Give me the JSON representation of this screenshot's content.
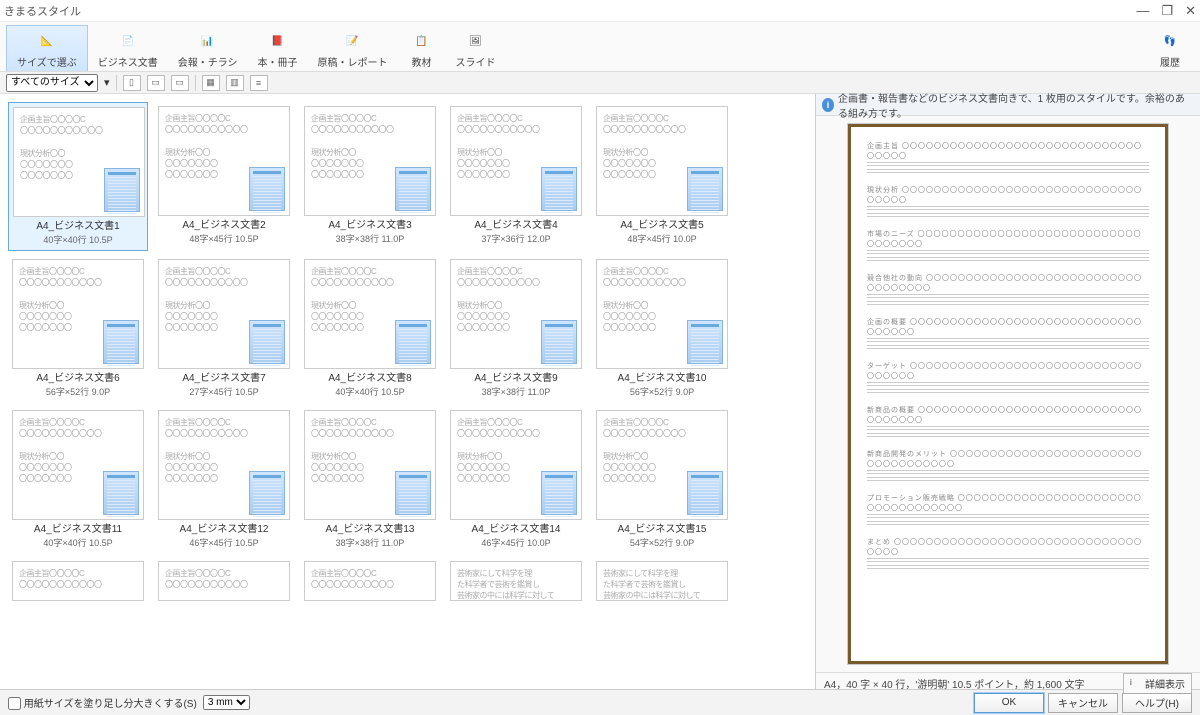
{
  "window": {
    "title": "きまるスタイル"
  },
  "win_ctrls": {
    "min": "—",
    "max": "❐",
    "close": "✕"
  },
  "ribbon": {
    "items": [
      {
        "label": "サイズで選ぶ",
        "active": true
      },
      {
        "label": "ビジネス文書"
      },
      {
        "label": "会報・チラシ"
      },
      {
        "label": "本・冊子"
      },
      {
        "label": "原稿・レポート"
      },
      {
        "label": "教材"
      },
      {
        "label": "スライド"
      }
    ],
    "right_label": "履歴"
  },
  "toolbar2": {
    "size_dropdown": "すべてのサイズ"
  },
  "placeholder": {
    "heading": "企画主旨〇〇〇〇C",
    "line": "〇〇〇〇〇〇〇〇〇〇〇",
    "sub": "現状分析〇〇"
  },
  "alt_placeholder": {
    "text1": "芸術家にして科学を理",
    "text2": "た科学者で芸術を鑑賞し",
    "text3": "芸術家の中には科学に対して"
  },
  "cards": [
    [
      {
        "name": "A4_ビジネス文書1",
        "spec": "40字×40行  10.5P",
        "selected": true
      },
      {
        "name": "A4_ビジネス文書2",
        "spec": "48字×45行  10.5P"
      },
      {
        "name": "A4_ビジネス文書3",
        "spec": "38字×38行  11.0P"
      },
      {
        "name": "A4_ビジネス文書4",
        "spec": "37字×36行  12.0P"
      },
      {
        "name": "A4_ビジネス文書5",
        "spec": "48字×45行  10.0P"
      }
    ],
    [
      {
        "name": "A4_ビジネス文書6",
        "spec": "56字×52行  9.0P"
      },
      {
        "name": "A4_ビジネス文書7",
        "spec": "27字×45行  10.5P"
      },
      {
        "name": "A4_ビジネス文書8",
        "spec": "40字×40行  10.5P"
      },
      {
        "name": "A4_ビジネス文書9",
        "spec": "38字×38行  11.0P"
      },
      {
        "name": "A4_ビジネス文書10",
        "spec": "56字×52行  9.0P"
      }
    ],
    [
      {
        "name": "A4_ビジネス文書11",
        "spec": "40字×40行  10.5P"
      },
      {
        "name": "A4_ビジネス文書12",
        "spec": "46字×45行  10.5P"
      },
      {
        "name": "A4_ビジネス文書13",
        "spec": "38字×38行  11.0P"
      },
      {
        "name": "A4_ビジネス文書14",
        "spec": "46字×45行  10.0P"
      },
      {
        "name": "A4_ビジネス文書15",
        "spec": "54字×52行  9.0P"
      }
    ]
  ],
  "preview": {
    "info": "企画書・報告書などのビジネス文書向きで、1 枚用のスタイルです。余裕のある組み方です。",
    "sections": [
      "企画主旨",
      "現状分析",
      "市場のニーズ",
      "競合他社の動向",
      "企画の概要",
      "ターゲット",
      "新商品の概要",
      "新商品開発のメリット",
      "プロモーション販売戦略",
      "まとめ"
    ],
    "footer_spec": "A4，40 字 × 40 行，'游明朝' 10.5 ポイント，約 1,600 文字",
    "detail_btn": "詳細表示"
  },
  "bottom": {
    "checkbox_label": "用紙サイズを塗り足し分大きくする(S)",
    "mm_value": "3 mm",
    "ok": "OK",
    "cancel": "キャンセル",
    "help": "ヘルプ(H)"
  }
}
